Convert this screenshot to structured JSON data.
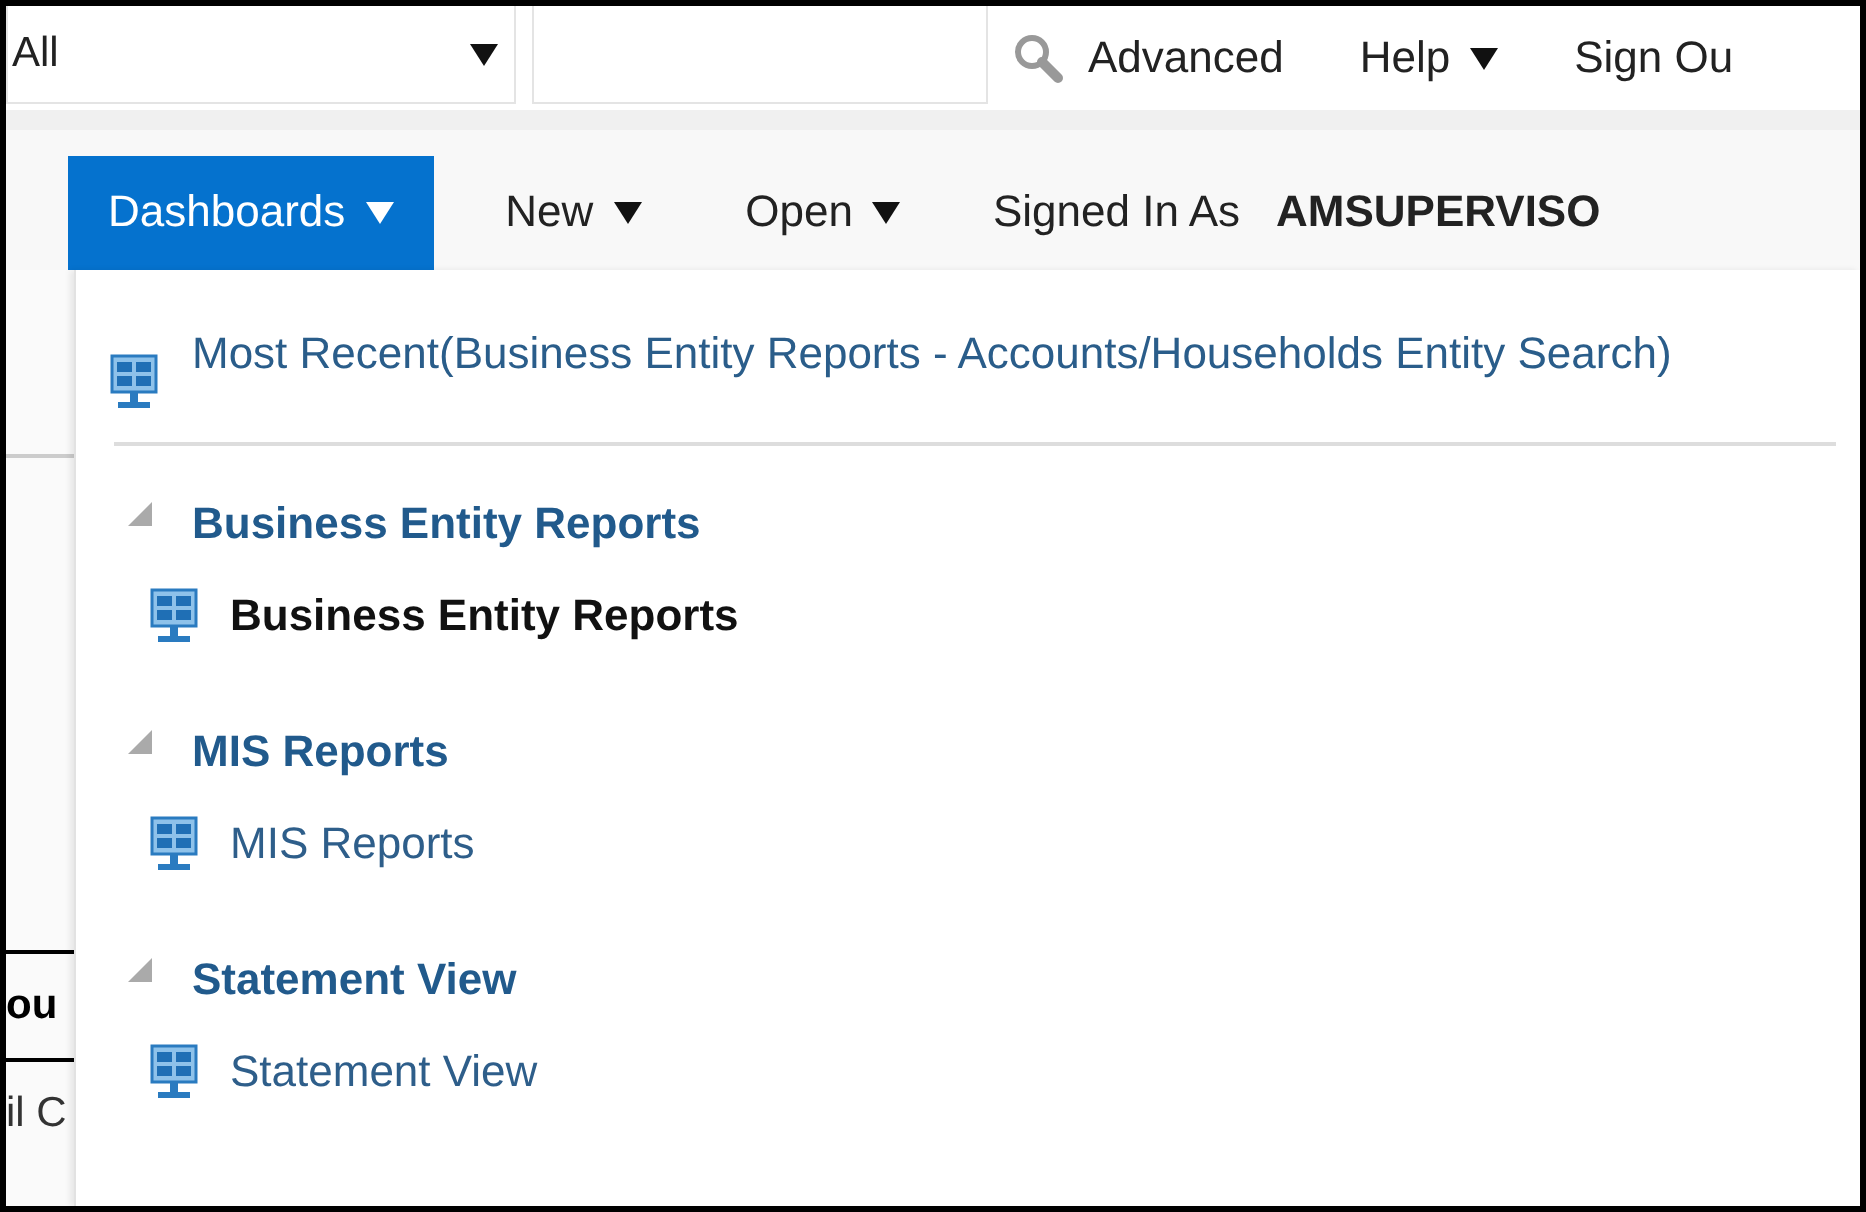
{
  "search_bar": {
    "scope": "All",
    "links": [
      {
        "label": "Advanced",
        "dropdown": false
      },
      {
        "label": "Help",
        "dropdown": true
      },
      {
        "label": "Sign Ou",
        "dropdown": false
      }
    ]
  },
  "nav": {
    "items": [
      {
        "label": "Dashboards",
        "selected": true,
        "dropdown": true
      },
      {
        "label": "New",
        "selected": false,
        "dropdown": true
      },
      {
        "label": "Open",
        "selected": false,
        "dropdown": true
      }
    ],
    "signed_in": {
      "label": "Signed In As",
      "user": "AMSUPERVISO"
    }
  },
  "background_text": [
    {
      "text": "ou",
      "bold": true
    },
    {
      "text": "il C",
      "bold": false
    }
  ],
  "dashboards_menu": {
    "most_recent": "Most Recent(Business Entity Reports - Accounts/Households Entity Search)",
    "sections": [
      {
        "title": "Business Entity Reports",
        "expanded": true,
        "items": [
          {
            "label": "Business Entity Reports",
            "selected": true
          }
        ]
      },
      {
        "title": "MIS Reports",
        "expanded": true,
        "items": [
          {
            "label": "MIS Reports",
            "selected": false
          }
        ]
      },
      {
        "title": "Statement View",
        "expanded": true,
        "items": [
          {
            "label": "Statement View",
            "selected": false
          }
        ]
      }
    ]
  }
}
